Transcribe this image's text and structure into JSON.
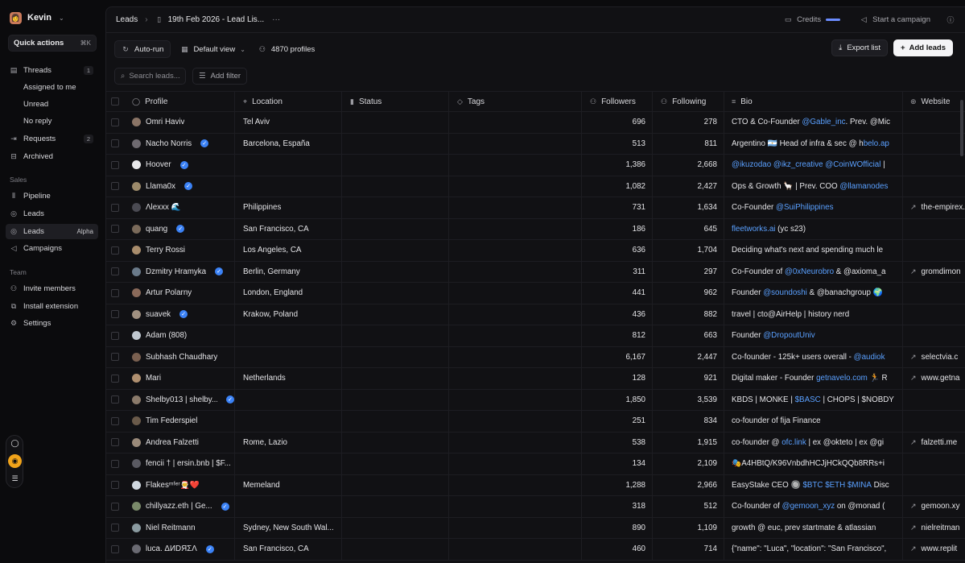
{
  "workspace": {
    "name": "Kevin"
  },
  "quick_actions": {
    "label": "Quick actions",
    "shortcut": "⌘K"
  },
  "sidebar": {
    "threads": {
      "label": "Threads",
      "badge": "1"
    },
    "assigned": {
      "label": "Assigned to me"
    },
    "unread": {
      "label": "Unread"
    },
    "noreply": {
      "label": "No reply"
    },
    "requests": {
      "label": "Requests",
      "badge": "2"
    },
    "archived": {
      "label": "Archived"
    },
    "sales_label": "Sales",
    "pipeline": {
      "label": "Pipeline"
    },
    "leads1": {
      "label": "Leads"
    },
    "leads2": {
      "label": "Leads",
      "tag": "Alpha"
    },
    "campaigns": {
      "label": "Campaigns"
    },
    "team_label": "Team",
    "invite": {
      "label": "Invite members"
    },
    "install": {
      "label": "Install extension"
    },
    "settings": {
      "label": "Settings"
    }
  },
  "breadcrumb": {
    "root": "Leads",
    "current": "19th Feb 2026 - Lead Lis..."
  },
  "top_right": {
    "credits": "Credits",
    "campaign": "Start a campaign"
  },
  "toolbar": {
    "autorun": "Auto-run",
    "view": "Default view",
    "profiles": "4870 profiles",
    "export": "Export list",
    "add_leads": "Add leads"
  },
  "filters": {
    "search_placeholder": "Search leads...",
    "add_filter": "Add filter"
  },
  "columns": {
    "profile": "Profile",
    "location": "Location",
    "status": "Status",
    "tags": "Tags",
    "followers": "Followers",
    "following": "Following",
    "bio": "Bio",
    "website": "Website"
  },
  "accent": "#5aa0ff",
  "rows": [
    {
      "name": "Omri Haviv",
      "verified": false,
      "location": "Tel Aviv",
      "followers": "696",
      "following": "278",
      "bio_text": "CTO & Co-Founder ",
      "bio_link": "@Gable_inc",
      "bio_after": ". Prev. @Mic",
      "website": "",
      "avatar": "#8a7466"
    },
    {
      "name": "Nacho Norris",
      "verified": true,
      "location": "Barcelona, España",
      "followers": "513",
      "following": "811",
      "bio_text": "Argentino 🇦🇷 Head of infra & sec @ h",
      "bio_link": "belo.ap",
      "bio_after": "",
      "website": "",
      "avatar": "#6e6a70"
    },
    {
      "name": "Hoover",
      "verified": true,
      "location": "",
      "followers": "1,386",
      "following": "2,668",
      "bio_text": "",
      "bio_link": "@ikuzodao @ikz_creative @CoinWOfficial",
      "bio_after": " |",
      "website": "",
      "avatar": "#e8e8ea"
    },
    {
      "name": "Llama0x",
      "verified": true,
      "location": "",
      "followers": "1,082",
      "following": "2,427",
      "bio_text": "Ops & Growth 🦙 | Prev. COO ",
      "bio_link": "@llamanodes",
      "bio_after": "",
      "website": "",
      "avatar": "#9c8a6a"
    },
    {
      "name": "Λlexxx 🌊",
      "verified": false,
      "location": "Philippines",
      "followers": "731",
      "following": "1,634",
      "bio_text": "Co-Founder ",
      "bio_link": "@SuiPhilippines",
      "bio_after": "",
      "website": "the-empirex.c",
      "avatar": "#4a4a52"
    },
    {
      "name": "quang",
      "verified": true,
      "location": "San Francisco, CA",
      "followers": "186",
      "following": "645",
      "bio_text": "",
      "bio_link": "fleetworks.ai",
      "bio_after": " (yc s23)",
      "website": "",
      "avatar": "#7a6a5a"
    },
    {
      "name": "Terry Rossi",
      "verified": false,
      "location": "Los Angeles, CA",
      "followers": "636",
      "following": "1,704",
      "bio_text": "Deciding what's next and spending much le",
      "bio_link": "",
      "bio_after": "",
      "website": "",
      "avatar": "#a88c6c"
    },
    {
      "name": "Dzmitry Hramyka",
      "verified": true,
      "location": "Berlin, Germany",
      "followers": "311",
      "following": "297",
      "bio_text": "Co-Founder of ",
      "bio_link": "@0xNeurobro",
      "bio_after": " & @axioma_a",
      "website": "gromdimon",
      "avatar": "#6a7a8a"
    },
    {
      "name": "Artur Polarny",
      "verified": false,
      "location": "London, England",
      "followers": "441",
      "following": "962",
      "bio_text": "Founder ",
      "bio_link": "@soundoshi",
      "bio_after": " & @banachgroup 🌍",
      "website": "",
      "avatar": "#8a6a5a"
    },
    {
      "name": "suavek",
      "verified": true,
      "location": "Krakow, Poland",
      "followers": "436",
      "following": "882",
      "bio_text": "travel | cto@AirHelp | history nerd",
      "bio_link": "",
      "bio_after": "",
      "website": "",
      "avatar": "#a09080"
    },
    {
      "name": "Adam (808)",
      "verified": false,
      "location": "",
      "followers": "812",
      "following": "663",
      "bio_text": "Founder ",
      "bio_link": "@DropoutUniv",
      "bio_after": "",
      "website": "",
      "avatar": "#c0c8d0"
    },
    {
      "name": "Subhash Chaudhary",
      "verified": false,
      "location": "",
      "followers": "6,167",
      "following": "2,447",
      "bio_text": "Co-founder - 125k+ users overall - ",
      "bio_link": "@audiok",
      "bio_after": "",
      "website": "selectvia.c",
      "avatar": "#7a6050"
    },
    {
      "name": "Mari",
      "verified": false,
      "location": "Netherlands",
      "followers": "128",
      "following": "921",
      "bio_text": "Digital maker - Founder ",
      "bio_link": "getnavelo.com",
      "bio_after": " 🏃 R",
      "website": "www.getna",
      "avatar": "#b09070"
    },
    {
      "name": "Shelby013 | shelby...",
      "verified": true,
      "location": "",
      "followers": "1,850",
      "following": "3,539",
      "bio_text": "KBDS | MONKE | ",
      "bio_link": "$BASC",
      "bio_after": " | CHOPS | $NOBDY",
      "website": "",
      "avatar": "#8a7a6a"
    },
    {
      "name": "Tim Federspiel",
      "verified": false,
      "location": "",
      "followers": "251",
      "following": "834",
      "bio_text": "co-founder of fija Finance",
      "bio_link": "",
      "bio_after": "",
      "website": "",
      "avatar": "#6a5a4a"
    },
    {
      "name": "Andrea Falzetti",
      "verified": false,
      "location": "Rome, Lazio",
      "followers": "538",
      "following": "1,915",
      "bio_text": "co-founder @ ",
      "bio_link": "ofc.link",
      "bio_after": " | ex @okteto | ex @gi",
      "website": "falzetti.me",
      "avatar": "#9a8a7a"
    },
    {
      "name": "fencii † | ersin.bnb | $F...",
      "verified": false,
      "location": "",
      "followers": "134",
      "following": "2,109",
      "bio_text": "🎭A4HBtQ/K96VnbdhHCJjHCkQQb8RRs+i",
      "bio_link": "",
      "bio_after": "",
      "website": "",
      "avatar": "#5a5a62"
    },
    {
      "name": "Flakesᵐᶠᵉʳ🧑‍🎄❤️",
      "verified": false,
      "location": "Memeland",
      "followers": "1,288",
      "following": "2,966",
      "bio_text": "EasyStake CEO 🔘 ",
      "bio_link": "$BTC $ETH $MINA",
      "bio_after": " Disc",
      "website": "",
      "avatar": "#d0d8e0"
    },
    {
      "name": "chillyazz.eth | Ge...",
      "verified": true,
      "location": "",
      "followers": "318",
      "following": "512",
      "bio_text": "Co-founder of ",
      "bio_link": "@gemoon_xyz",
      "bio_after": " on @monad (",
      "website": "gemoon.xy",
      "avatar": "#7a8a6a"
    },
    {
      "name": "Niel Reitmann",
      "verified": false,
      "location": "Sydney, New South Wal...",
      "followers": "890",
      "following": "1,109",
      "bio_text": "growth @ euc, prev startmate & atlassian",
      "bio_link": "",
      "bio_after": "",
      "website": "nielreitman",
      "avatar": "#8a9aa0"
    },
    {
      "name": "luca. ΔИDЯΣΛ",
      "verified": true,
      "location": "San Francisco, CA",
      "followers": "460",
      "following": "714",
      "bio_text": "{\"name\": \"Luca\", \"location\": \"San Francisco\",",
      "bio_link": "",
      "bio_after": "",
      "website": "www.replit",
      "avatar": "#6a6a72"
    }
  ]
}
